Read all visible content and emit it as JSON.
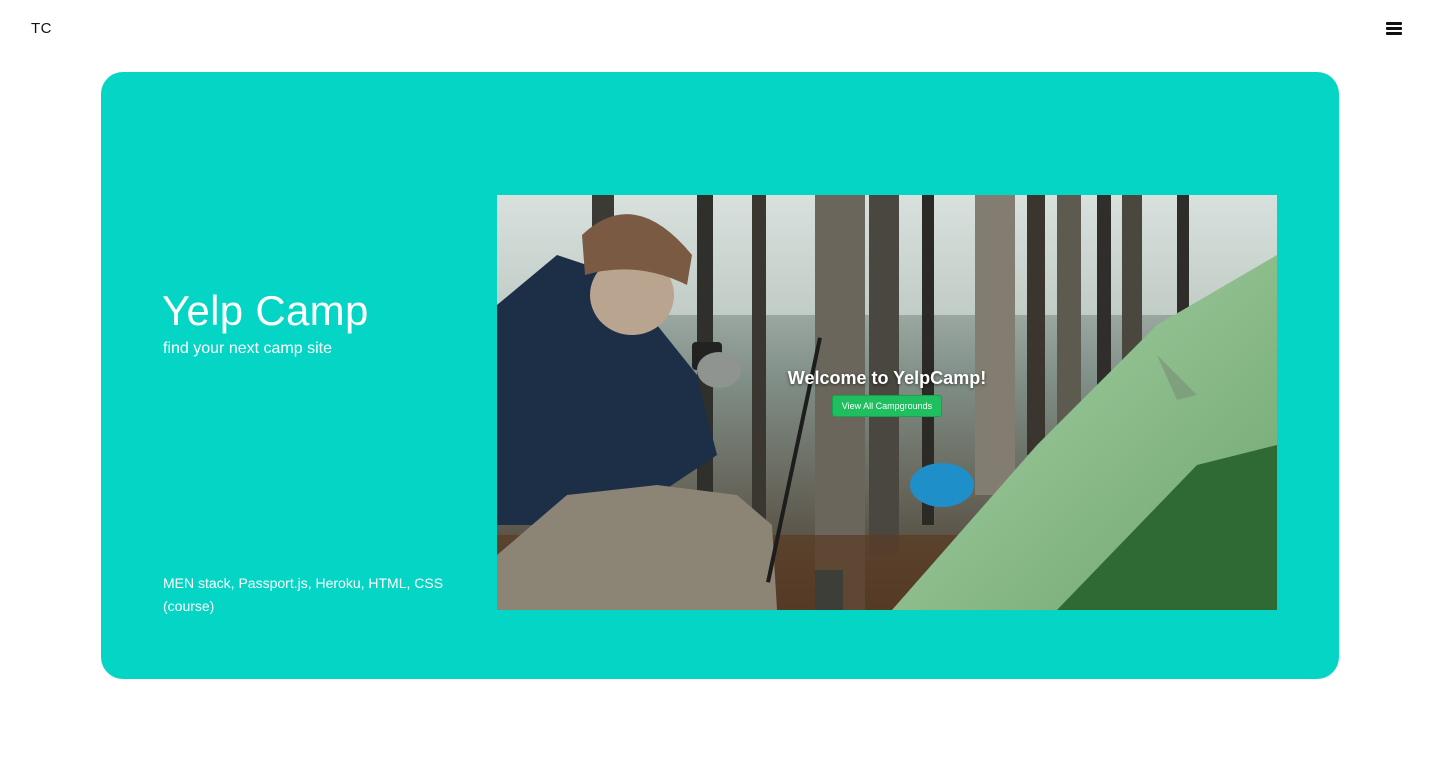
{
  "nav": {
    "logo": "TC",
    "menu_icon": "hamburger-icon"
  },
  "project": {
    "title": "Yelp Camp",
    "subtitle": "find your next camp site",
    "stack": "MEN stack, Passport.js, Heroku, HTML, CSS (course)",
    "card_color": "#04d5c4"
  },
  "preview": {
    "welcome": "Welcome to YelpCamp!",
    "cta_label": "View All Campgrounds",
    "cta_color": "#1fbe5f"
  }
}
